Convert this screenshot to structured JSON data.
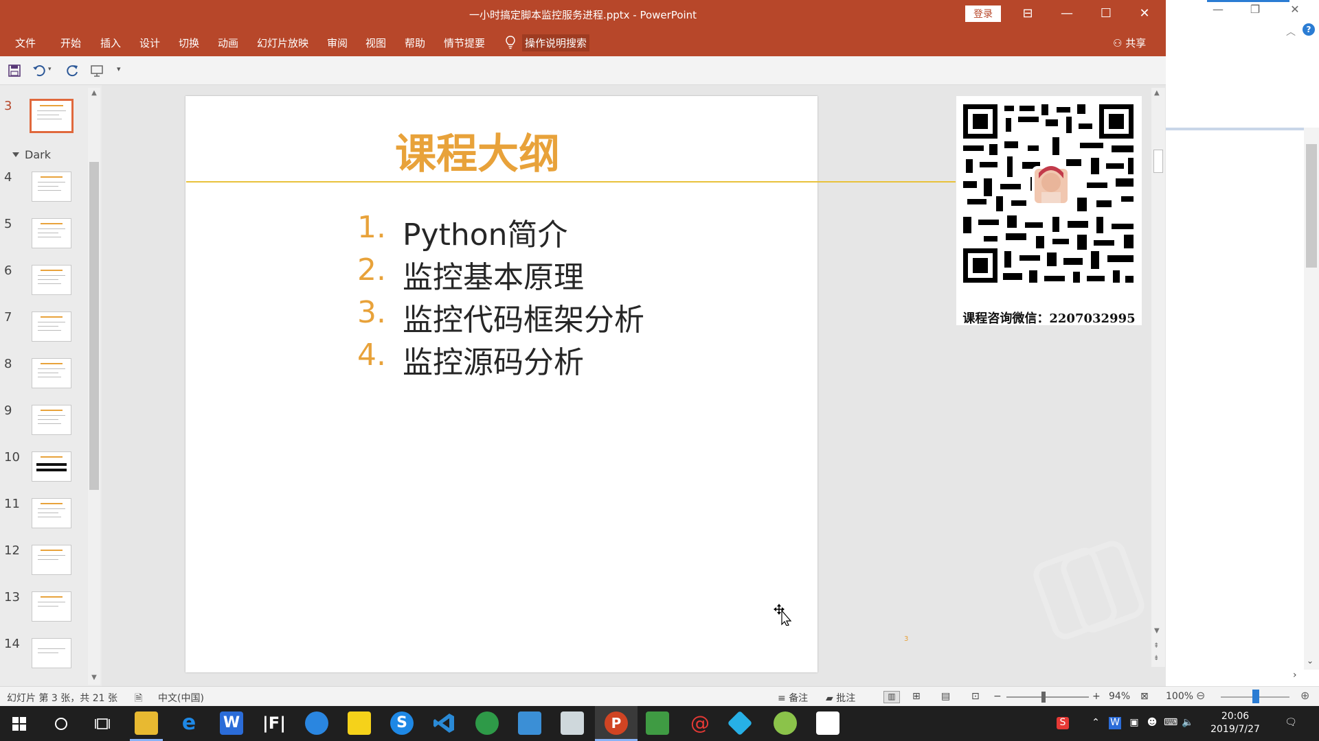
{
  "window": {
    "title": "一小时搞定脚本监控服务进程.pptx  -  PowerPoint",
    "login_label": "登录"
  },
  "menu": {
    "items": [
      "文件",
      "开始",
      "插入",
      "设计",
      "切换",
      "动画",
      "幻灯片放映",
      "审阅",
      "视图",
      "帮助",
      "情节提要"
    ],
    "search_label": "操作说明搜索",
    "share_label": "共享"
  },
  "thumbs": {
    "section": "Dark",
    "numbers": [
      "3",
      "4",
      "5",
      "6",
      "7",
      "8",
      "9",
      "10",
      "11",
      "12",
      "13",
      "14"
    ]
  },
  "slide": {
    "title": "课程大纲",
    "list": [
      {
        "num": "1.",
        "text": "Python简介"
      },
      {
        "num": "2.",
        "text": "监控基本原理"
      },
      {
        "num": "3.",
        "text": "监控代码框架分析"
      },
      {
        "num": "4.",
        "text": "监控源码分析"
      }
    ],
    "page_number": "3",
    "qr_caption": "课程咨询微信：2207032995"
  },
  "status": {
    "slide_info": "幻灯片 第 3 张，共 21 张",
    "language": "中文(中国)",
    "notes_label": "备注",
    "comments_label": "批注",
    "zoom": "94%",
    "bg_zoom": "100%"
  },
  "taskbar": {
    "time": "20:06",
    "date": "2019/7/27"
  },
  "colors": {
    "ppt_red": "#b7472a",
    "title_orange": "#e8a23a"
  }
}
